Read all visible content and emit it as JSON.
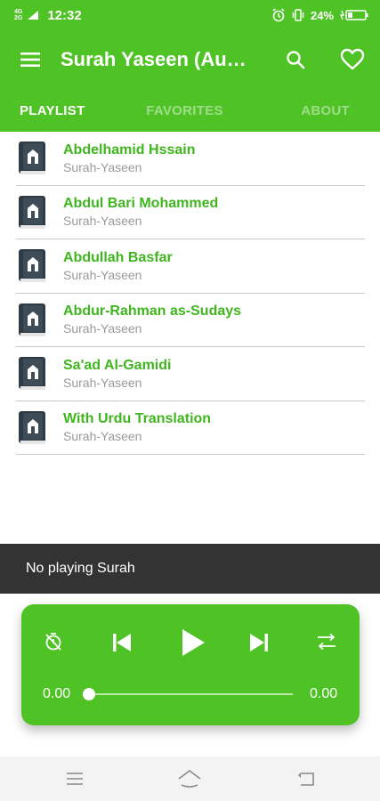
{
  "status_bar": {
    "network_top": "4G",
    "network_bottom": "2G",
    "time": "12:32",
    "battery": "24%"
  },
  "appbar": {
    "title": "Surah Yaseen (Audio)",
    "menu_icon": "menu-icon",
    "search_icon": "search-icon",
    "favorite_icon": "heart-icon"
  },
  "tabs": [
    {
      "label": "PLAYLIST",
      "active": true
    },
    {
      "label": "FAVORITES",
      "active": false
    },
    {
      "label": "ABOUT",
      "active": false
    }
  ],
  "playlist": [
    {
      "title": "Abdelhamid Hssain",
      "subtitle": "Surah-Yaseen"
    },
    {
      "title": "Abdul Bari Mohammed",
      "subtitle": "Surah-Yaseen"
    },
    {
      "title": "Abdullah Basfar",
      "subtitle": "Surah-Yaseen"
    },
    {
      "title": "Abdur-Rahman as-Sudays",
      "subtitle": "Surah-Yaseen"
    },
    {
      "title": "Sa'ad Al-Gamidi",
      "subtitle": "Surah-Yaseen"
    },
    {
      "title": "With Urdu Translation",
      "subtitle": "Surah-Yaseen"
    }
  ],
  "now_playing": "No playing Surah",
  "player": {
    "elapsed": "0.00",
    "duration": "0.00",
    "progress": 0
  },
  "colors": {
    "primary": "#4fc226",
    "accent_text": "#3fb51e",
    "now_bar": "#333333"
  }
}
